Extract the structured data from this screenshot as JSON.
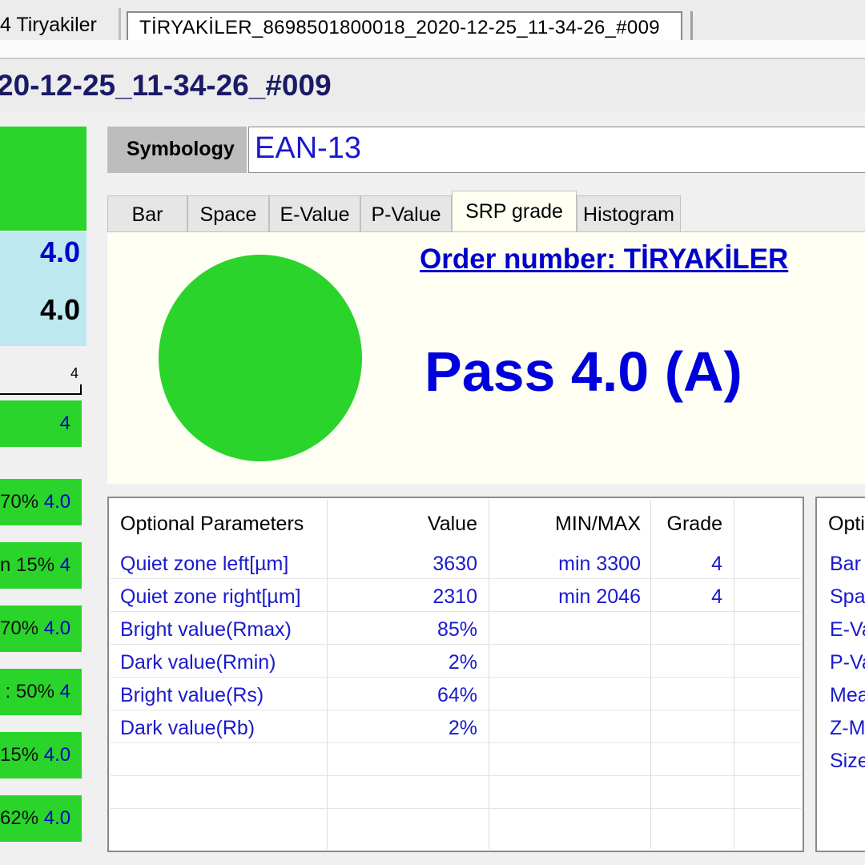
{
  "top_tabs": {
    "previous_label": "4  Tiryakiler",
    "active_label": "TİRYAKİLER_8698501800018_2020-12-25_11-34-26_#009"
  },
  "title": "20-12-25_11-34-26_#009",
  "left_column": {
    "grade_top": "4.0",
    "grade_bottom": "4.0",
    "scale_label": "4",
    "rows": [
      {
        "pct": "",
        "grade": "4"
      },
      {
        "pct": "70%",
        "grade": "4.0"
      },
      {
        "pct": "n 15%",
        "grade": "4"
      },
      {
        "pct": "70%",
        "grade": "4.0"
      },
      {
        "pct": ": 50%",
        "grade": "4"
      },
      {
        "pct": "15%",
        "grade": "4.0"
      },
      {
        "pct": "62%",
        "grade": "4.0"
      }
    ]
  },
  "symbology": {
    "label": "Symbology",
    "value": "EAN-13"
  },
  "tabs": [
    "Bar",
    "Space",
    "E-Value",
    "P-Value",
    "SRP grade",
    "Histogram"
  ],
  "active_tab": "SRP grade",
  "srp": {
    "order_number": "Order number: TİRYAKİLER",
    "result": "Pass 4.0 (A)",
    "status_color": "#2ad42a"
  },
  "optional_parameters": {
    "headers": [
      "Optional Parameters",
      "Value",
      "MIN/MAX",
      "Grade"
    ],
    "rows": [
      {
        "name": "Quiet zone left[µm]",
        "value": "3630",
        "minmax": "min 3300",
        "grade": "4"
      },
      {
        "name": "Quiet zone right[µm]",
        "value": "2310",
        "minmax": "min 2046",
        "grade": "4"
      },
      {
        "name": "Bright value(Rmax)",
        "value": "85%",
        "minmax": "",
        "grade": ""
      },
      {
        "name": "Dark value(Rmin)",
        "value": "2%",
        "minmax": "",
        "grade": ""
      },
      {
        "name": "Bright value(Rs)",
        "value": "64%",
        "minmax": "",
        "grade": ""
      },
      {
        "name": "Dark value(Rb)",
        "value": "2%",
        "minmax": "",
        "grade": ""
      }
    ]
  },
  "second_table": {
    "header": "Opti",
    "rows": [
      "Bar",
      "Spa",
      "E-Va",
      "P-Va",
      "Mea",
      "Z-M",
      "Size"
    ]
  },
  "colors": {
    "accent_blue": "#0000cc",
    "pass_green": "#2ad42a",
    "info_blue_bg": "#bde8ef"
  }
}
